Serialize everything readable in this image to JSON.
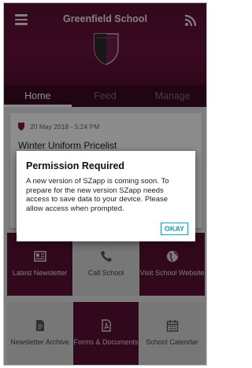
{
  "app": {
    "title": "Greenfield School"
  },
  "tabs": [
    {
      "label": "Home",
      "active": true
    },
    {
      "label": "Feed",
      "active": false
    },
    {
      "label": "Manage",
      "active": false
    }
  ],
  "post": {
    "date": "20 May 2018 - 5:24 PM",
    "title": "Winter Uniform Pricelist"
  },
  "tiles": [
    {
      "label": "Latest Newsletter",
      "icon": "newsletter-icon"
    },
    {
      "label": "Call School",
      "icon": "phone-icon"
    },
    {
      "label": "Visit School Website",
      "icon": "globe-icon"
    },
    {
      "label": "Newsletter Archive",
      "icon": "document-icon"
    },
    {
      "label": "Forms & Documents",
      "icon": "pdf-icon"
    },
    {
      "label": "School Calendar",
      "icon": "calendar-icon"
    }
  ],
  "dialog": {
    "title": "Permission Required",
    "message": "A new version of SZapp is coming soon. To prepare for the new version SZapp needs access to save data to your device. Please allow access when prompted.",
    "ok_label": "OKAY"
  },
  "colors": {
    "brand": "#5c0f33",
    "accent": "#1aa0b0"
  }
}
